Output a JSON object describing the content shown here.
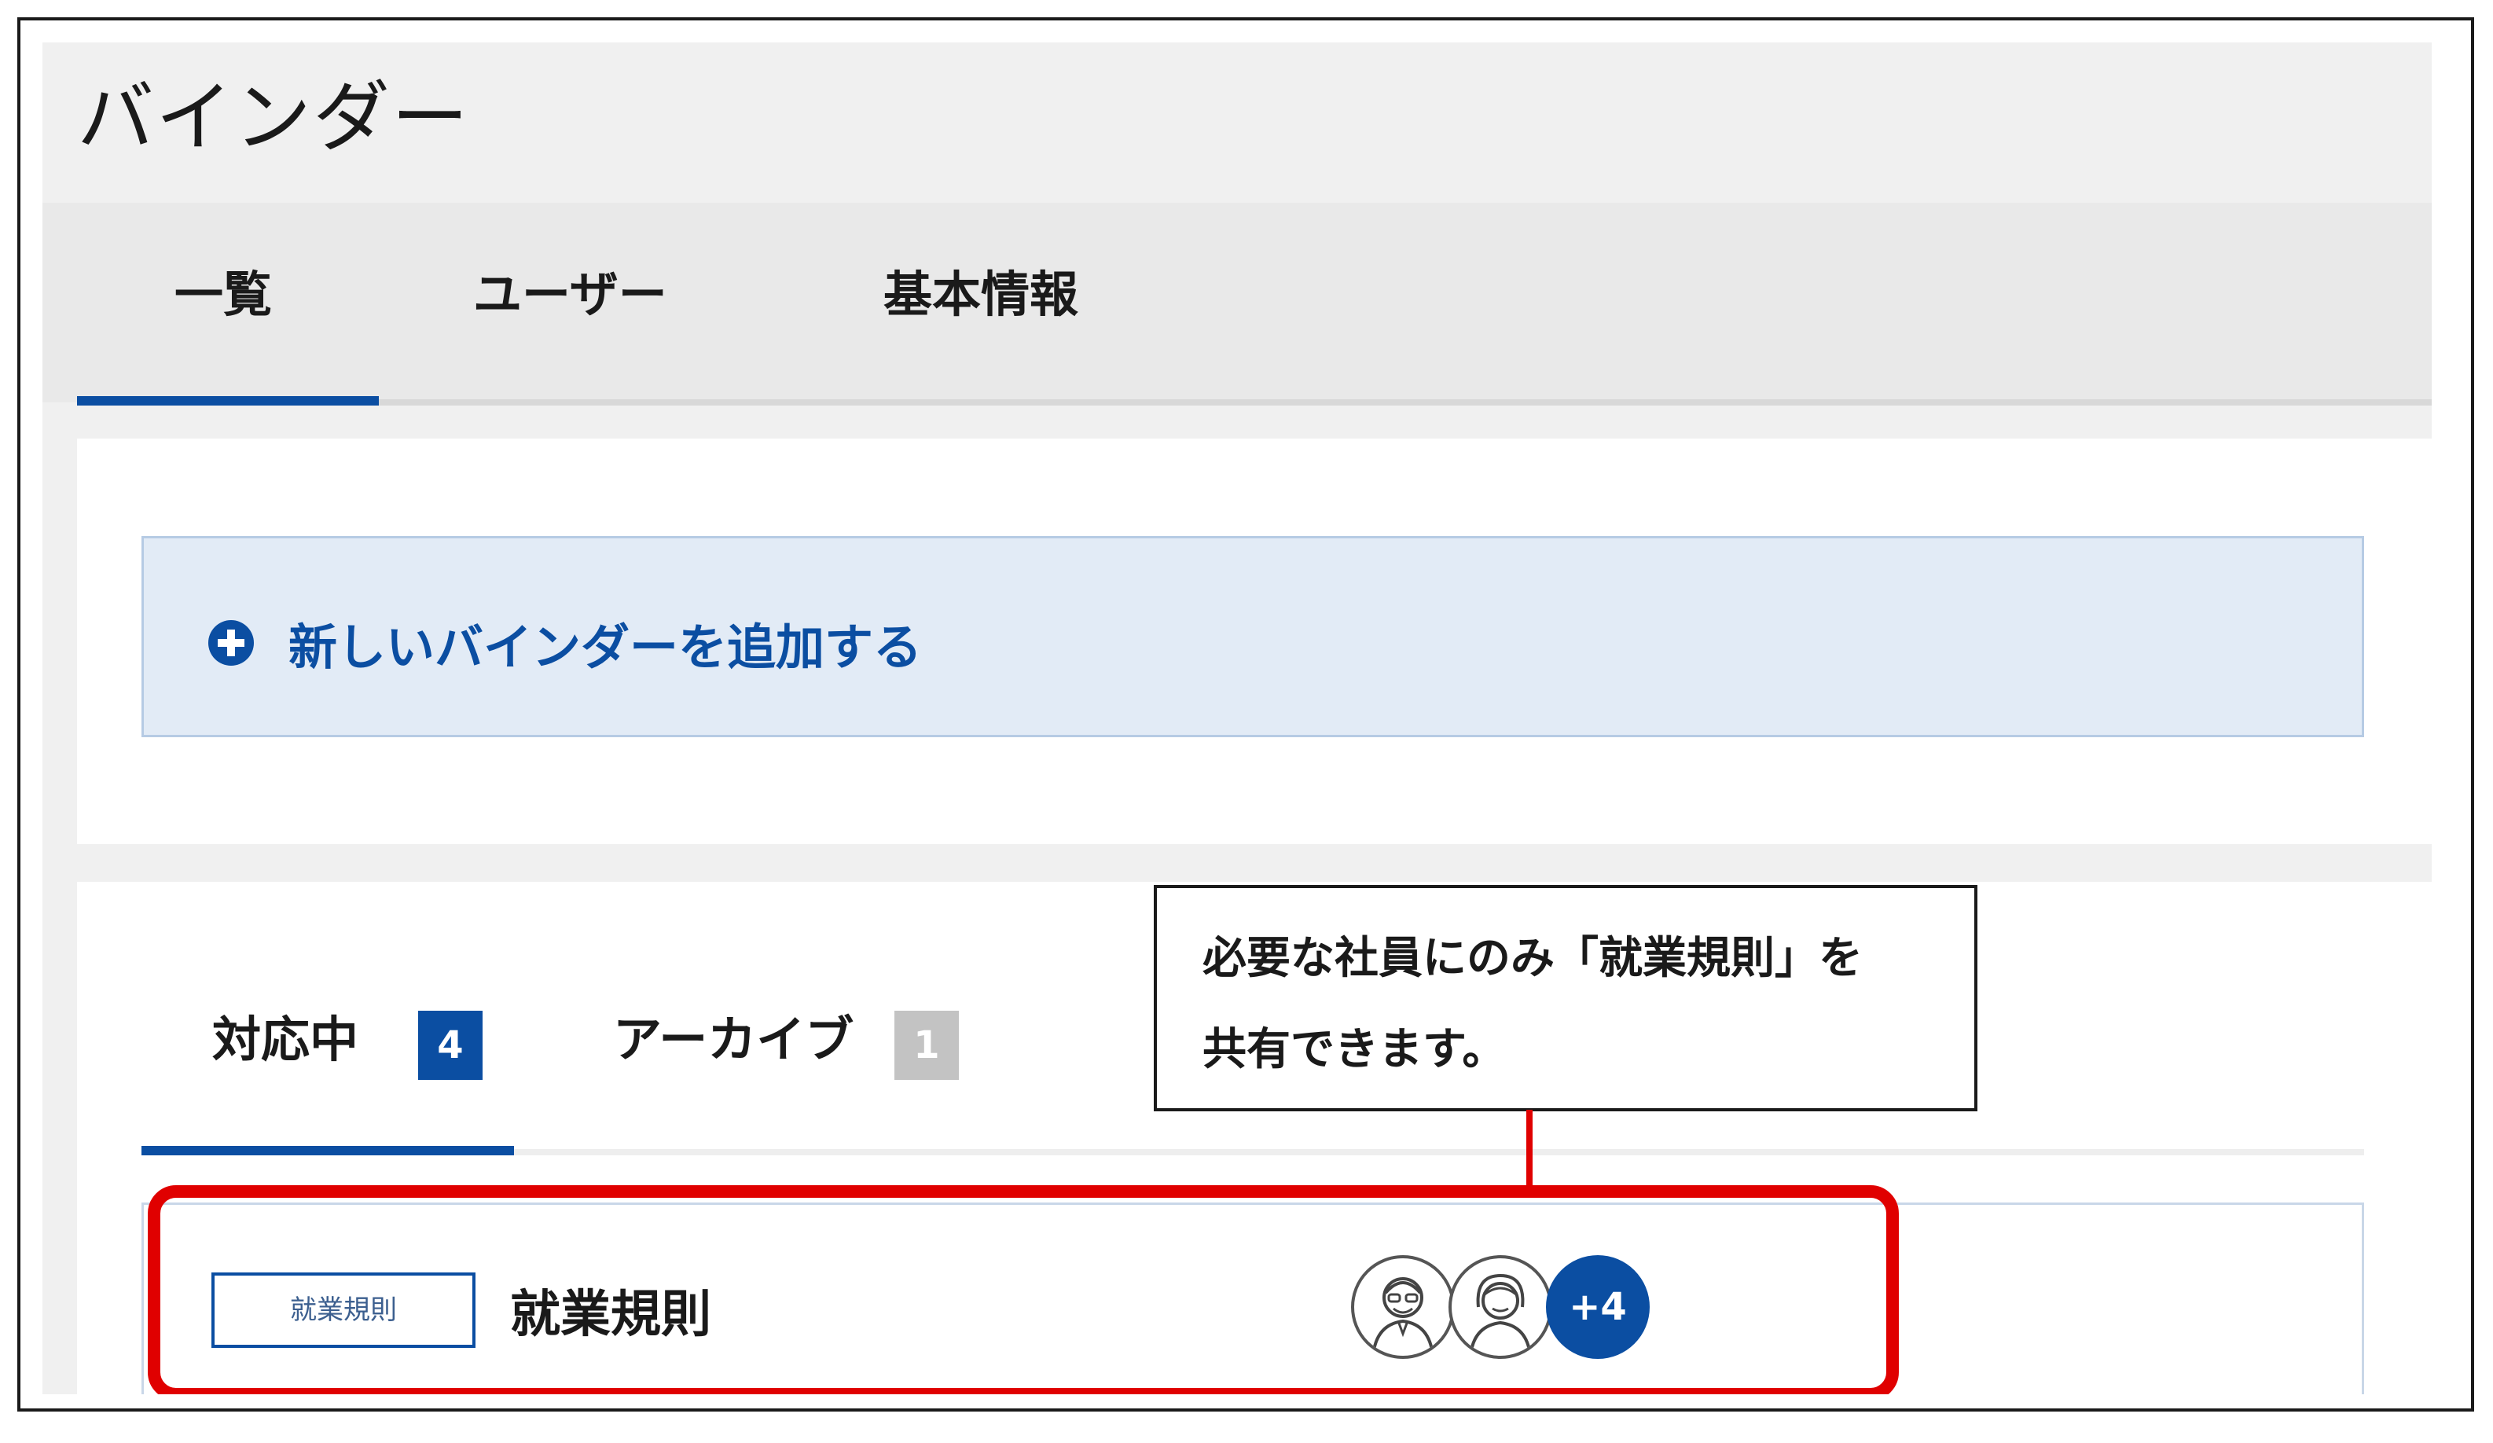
{
  "app": {
    "title": "バインダー"
  },
  "tabs": [
    {
      "label": "一覧",
      "active": true
    },
    {
      "label": "ユーザー",
      "active": false
    },
    {
      "label": "基本情報",
      "active": false
    }
  ],
  "add_binder": {
    "label": "新しいバインダーを追加する",
    "icon": "plus-circle-icon"
  },
  "subtabs": [
    {
      "label": "対応中",
      "count": "4",
      "active": true
    },
    {
      "label": "アーカイブ",
      "count": "1",
      "active": false
    }
  ],
  "binder_list": [
    {
      "category": "就業規則",
      "name": "就業規則",
      "avatars": [
        "man-avatar-icon",
        "woman-avatar-icon"
      ],
      "more_members": "+4"
    }
  ],
  "callout": {
    "line1": "必要な社員にのみ「就業規則」を",
    "line2": "共有できます。"
  },
  "colors": {
    "accent": "#0b4ea2",
    "highlight": "#e00000",
    "badge_inactive": "#c3c3c3"
  }
}
